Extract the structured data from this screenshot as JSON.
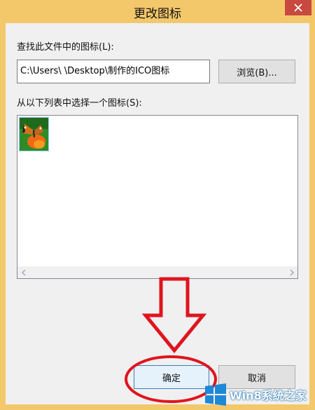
{
  "window": {
    "title": "更改图标"
  },
  "file_field": {
    "label": "查找此文件中的图标(L):",
    "value": "C:\\Users\\        \\Desktop\\制作的ICO图标"
  },
  "buttons": {
    "browse": "浏览(B)...",
    "ok": "确定",
    "cancel": "取消"
  },
  "icon_list": {
    "label": "从以下列表中选择一个图标(S):",
    "items": [
      {
        "icon": "butterfly-flower-icon",
        "selected": true
      }
    ]
  },
  "watermark": {
    "text": "Win8系统之家"
  },
  "annotation": {
    "color": "#e0141e"
  }
}
